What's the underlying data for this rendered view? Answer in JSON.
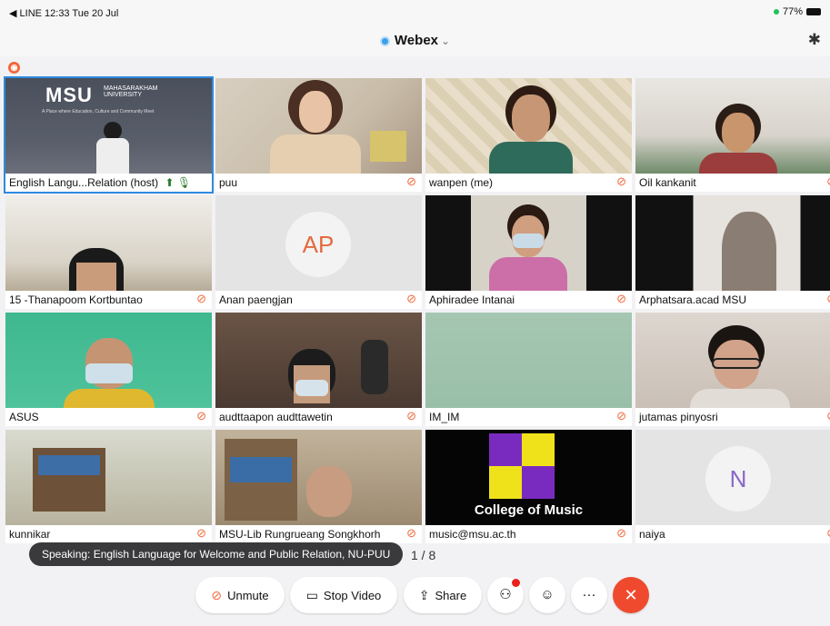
{
  "status": {
    "left": "◀ LINE  12:33  Tue 20 Jul",
    "battery": "77%"
  },
  "app": {
    "title": "Webex"
  },
  "recording_badge": "●",
  "tiles": [
    {
      "name": "English Langu...Relation (host)",
      "extra": "⬆ 🎙"
    },
    {
      "name": "puu"
    },
    {
      "name": "wanpen (me)"
    },
    {
      "name": "Oil kankanit"
    },
    {
      "name": "15 -Thanapoom Kortbuntao"
    },
    {
      "name": "Anan paengjan",
      "avatar": "AP"
    },
    {
      "name": "Aphiradee Intanai"
    },
    {
      "name": "Arphatsara.acad MSU"
    },
    {
      "name": "ASUS"
    },
    {
      "name": "audttaapon audttawetin"
    },
    {
      "name": "IM_IM"
    },
    {
      "name": "jutamas pinyosri"
    },
    {
      "name": "kunnikar"
    },
    {
      "name": "MSU-Lib Rungrueang Songkhorh"
    },
    {
      "name": "music@msu.ac.th",
      "slide_text": "College of Music"
    },
    {
      "name": "naiya",
      "avatar": "N"
    }
  ],
  "msu_slide": {
    "logo": "MSU",
    "sub": "MAHASARAKHAM UNIVERSITY",
    "tagline": "A Place where Education, Culture and Community Meet"
  },
  "speaking": "Speaking: English Language for Welcome and Public Relation, NU-PUU",
  "page": "1 / 8",
  "controls": {
    "unmute": "Unmute",
    "stop_video": "Stop Video",
    "share": "Share"
  }
}
